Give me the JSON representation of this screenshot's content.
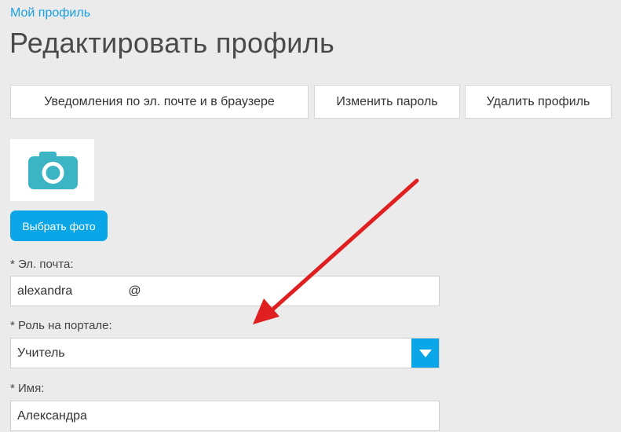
{
  "breadcrumb": "Мой профиль",
  "title": "Редактировать профиль",
  "tabs": {
    "notifications": "Уведомления по эл. почте и в браузере",
    "change_password": "Изменить пароль",
    "delete_profile": "Удалить профиль"
  },
  "photo": {
    "icon": "camera-icon",
    "button_label": "Выбрать фото"
  },
  "form": {
    "email_label": "* Эл. почта:",
    "email_value": "alexandra                @",
    "role_label": "* Роль на портале:",
    "role_value": "Учитель",
    "name_label": "* Имя:",
    "name_value": "Александра"
  },
  "colors": {
    "accent": "#0ba6e8",
    "camera": "#3bb5c4",
    "annotation_arrow": "#e02020"
  }
}
